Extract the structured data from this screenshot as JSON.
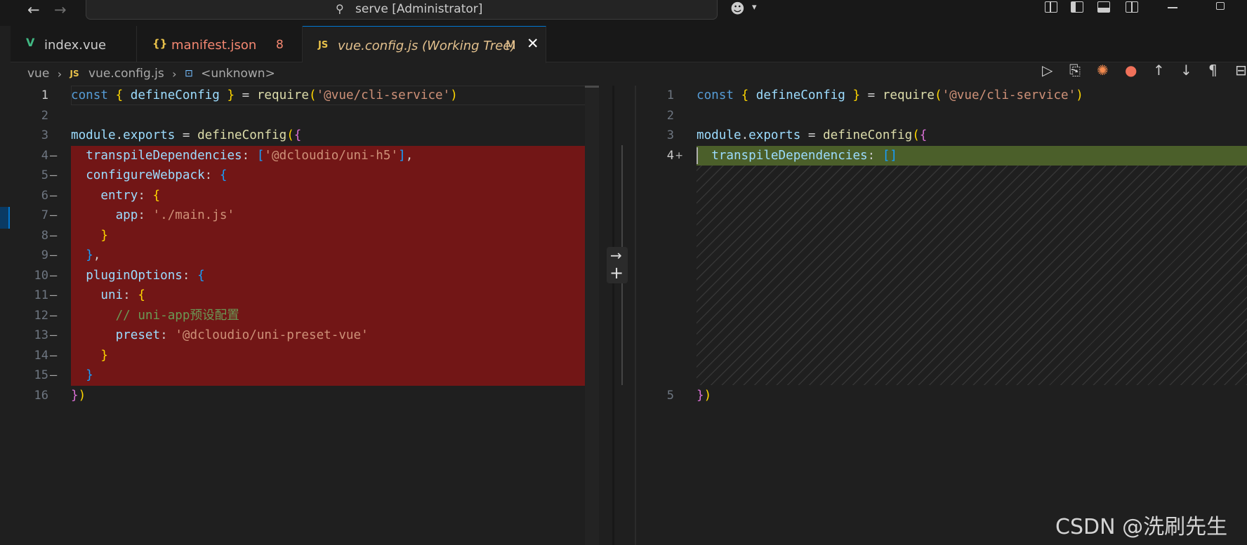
{
  "titlebar": {
    "search_label": "serve [Administrator]",
    "icons": [
      "arrow-left-icon",
      "arrow-right-icon",
      "search-icon",
      "copilot-icon",
      "layout-icons",
      "minimize-icon",
      "restore-icon"
    ]
  },
  "tabs": [
    {
      "icon": "vue-file-icon",
      "label": "index.vue",
      "badge": ""
    },
    {
      "icon": "json-file-icon",
      "label": "manifest.json",
      "badge": "8"
    },
    {
      "icon": "js-file-icon",
      "label": "vue.config.js (Working Tree)",
      "badge": "M",
      "active": true
    }
  ],
  "editor_actions": [
    "run-icon",
    "open-file-icon",
    "copilot-sparkle-icon",
    "gitlens-icon",
    "prev-change-icon",
    "next-change-icon",
    "whitespace-icon",
    "split-icon"
  ],
  "breadcrumb": {
    "folder": "vue",
    "file_icon": "JS",
    "file": "vue.config.js",
    "symbol": "<unknown>"
  },
  "left_editor": {
    "lines": [
      {
        "num": "1",
        "mark": "",
        "active": true
      },
      {
        "num": "2",
        "mark": ""
      },
      {
        "num": "3",
        "mark": ""
      },
      {
        "num": "4",
        "mark": "—"
      },
      {
        "num": "5",
        "mark": "—"
      },
      {
        "num": "6",
        "mark": "—"
      },
      {
        "num": "7",
        "mark": "—"
      },
      {
        "num": "8",
        "mark": "—"
      },
      {
        "num": "9",
        "mark": "—"
      },
      {
        "num": "10",
        "mark": "—"
      },
      {
        "num": "11",
        "mark": "—"
      },
      {
        "num": "12",
        "mark": "—"
      },
      {
        "num": "13",
        "mark": "—"
      },
      {
        "num": "14",
        "mark": "—"
      },
      {
        "num": "15",
        "mark": "—"
      },
      {
        "num": "16",
        "mark": ""
      }
    ],
    "code": {
      "l1": {
        "kw": "const",
        "b_open": "{",
        "name": "defineConfig",
        "b_close": "}",
        "eq": "=",
        "fn": "require",
        "p_open": "(",
        "str": "'@vue/cli-service'",
        "p_close": ")"
      },
      "l3": {
        "obj": "module",
        "dot": ".",
        "prop": "exports",
        "eq": "=",
        "fn": "defineConfig",
        "p_open": "(",
        "b_open": "{"
      },
      "l4": {
        "key": "transpileDependencies",
        "colon": ":",
        "sq_open": "[",
        "str": "'@dcloudio/uni-h5'",
        "sq_close": "]",
        "comma": ","
      },
      "l5": {
        "key": "configureWebpack",
        "colon": ":",
        "b_open": "{"
      },
      "l6": {
        "key": "entry",
        "colon": ":",
        "b_open": "{"
      },
      "l7": {
        "key": "app",
        "colon": ":",
        "str": "'./main.js'"
      },
      "l8": {
        "b_close": "}"
      },
      "l9": {
        "b_close": "}",
        "comma": ","
      },
      "l10": {
        "key": "pluginOptions",
        "colon": ":",
        "b_open": "{"
      },
      "l11": {
        "key": "uni",
        "colon": ":",
        "b_open": "{"
      },
      "l12": {
        "comment": "// uni-app预设配置"
      },
      "l13": {
        "key": "preset",
        "colon": ":",
        "str": "'@dcloudio/uni-preset-vue'"
      },
      "l14": {
        "b_close": "}"
      },
      "l15": {
        "b_close": "}"
      },
      "l16": {
        "b_close": "}",
        "p_close": ")"
      }
    }
  },
  "right_editor": {
    "lines": [
      {
        "num": "1",
        "mark": ""
      },
      {
        "num": "2",
        "mark": ""
      },
      {
        "num": "3",
        "mark": ""
      },
      {
        "num": "4",
        "mark": "+",
        "active": true
      },
      {
        "num": "5",
        "mark": ""
      }
    ],
    "code": {
      "l1": {
        "kw": "const",
        "b_open": "{",
        "name": "defineConfig",
        "b_close": "}",
        "eq": "=",
        "fn": "require",
        "p_open": "(",
        "str": "'@vue/cli-service'",
        "p_close": ")"
      },
      "l3": {
        "obj": "module",
        "dot": ".",
        "prop": "exports",
        "eq": "=",
        "fn": "defineConfig",
        "p_open": "(",
        "b_open": "{"
      },
      "l4": {
        "key": "transpileDependencies",
        "colon": ":",
        "sq": "[]"
      },
      "l5": {
        "b_close": "}",
        "p_close": ")"
      }
    }
  },
  "diff_gutter_actions": [
    "revert-arrow-icon",
    "stage-plus-icon"
  ],
  "watermark": "CSDN @洗刷先生"
}
